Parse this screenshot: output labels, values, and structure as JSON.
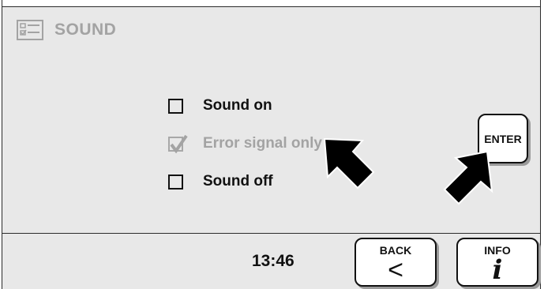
{
  "header": {
    "title": "SOUND",
    "icon": "settings-list-icon"
  },
  "options": [
    {
      "label": "Sound on",
      "checked": false,
      "disabled": false
    },
    {
      "label": "Error signal only",
      "checked": true,
      "disabled": true
    },
    {
      "label": "Sound off",
      "checked": false,
      "disabled": false
    }
  ],
  "enter_button": {
    "label": "ENTER"
  },
  "footer": {
    "time": "13:46",
    "back_button": {
      "label": "BACK",
      "glyph": "<"
    },
    "info_button": {
      "label": "INFO",
      "glyph": "i"
    }
  },
  "annotations": {
    "arrows": [
      "pointer-arrow-to-error-signal",
      "pointer-arrow-to-enter"
    ],
    "arrow_color": "#000000"
  },
  "colors": {
    "panel": "#e8e8e8",
    "disabled_text": "#a3a3a3",
    "text": "#111111"
  }
}
